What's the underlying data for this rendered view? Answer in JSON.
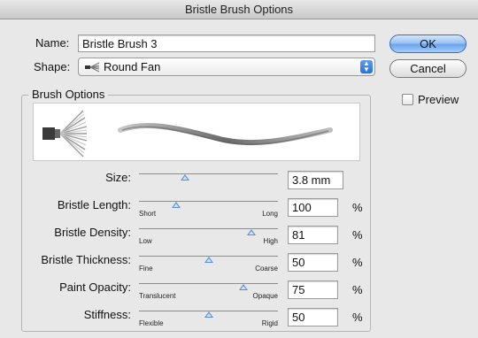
{
  "window": {
    "title": "Bristle Brush Options"
  },
  "name": {
    "label": "Name:",
    "value": "Bristle Brush 3"
  },
  "shape": {
    "label": "Shape:",
    "value": "Round Fan",
    "icon": "fan-brush-icon"
  },
  "buttons": {
    "ok": "OK",
    "cancel": "Cancel"
  },
  "preview_checkbox": {
    "label": "Preview",
    "checked": false
  },
  "brush_options": {
    "legend": "Brush Options",
    "sliders": [
      {
        "label": "Size:",
        "min_label": "",
        "max_label": "",
        "value": "3.8 mm",
        "unit": "",
        "level": 0.33
      },
      {
        "label": "Bristle Length:",
        "min_label": "Short",
        "max_label": "Long",
        "value": "100",
        "unit": "%",
        "level": 0.27
      },
      {
        "label": "Bristle Density:",
        "min_label": "Low",
        "max_label": "High",
        "value": "81",
        "unit": "%",
        "level": 0.81
      },
      {
        "label": "Bristle Thickness:",
        "min_label": "Fine",
        "max_label": "Coarse",
        "value": "50",
        "unit": "%",
        "level": 0.5
      },
      {
        "label": "Paint Opacity:",
        "min_label": "Translucent",
        "max_label": "Opaque",
        "value": "75",
        "unit": "%",
        "level": 0.75
      },
      {
        "label": "Stiffness:",
        "min_label": "Flexible",
        "max_label": "Rigid",
        "value": "50",
        "unit": "%",
        "level": 0.5
      }
    ]
  },
  "colors": {
    "accent": "#6aa4ee",
    "thumb": "#5a8fd6"
  }
}
